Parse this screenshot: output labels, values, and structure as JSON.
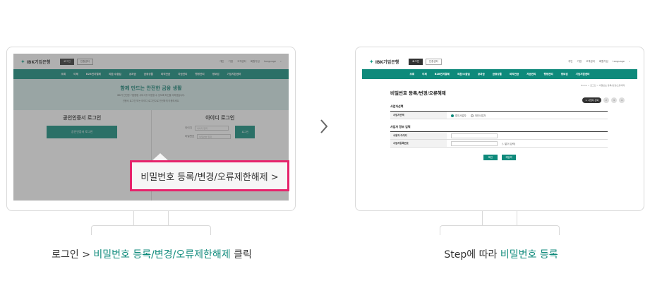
{
  "left_screen": {
    "logo": "IBK기업은행",
    "login_button": "로그인",
    "join_button": "인증센터",
    "top_links": [
      "개인",
      "기업",
      "고객센터",
      "회원가입",
      "Language"
    ],
    "nav": [
      "조회",
      "이체",
      "B2B전자결제",
      "외환/수출입",
      "공과금",
      "금융상품",
      "퇴직연금",
      "자금관리",
      "행정관리",
      "정보검",
      "기업지원센터"
    ],
    "hero_title": "함께 만드는 안전한 금융 생활",
    "hero_text_1": "IBK가 안전한 기업뱅킹 서비스를 이용할 수 있도록 최선을 다하겠습니다.",
    "hero_text_2": "인증서 로그인 또는 아이디 로그인으로 안전하게 이용하세요.",
    "cert_login_title": "공인인증서 로그인",
    "cert_login_button": "공인인증서 로그인",
    "id_login_title": "아이디 로그인",
    "id_label": "아이디",
    "pw_label": "비밀번호",
    "id_placeholder": "아이디 입력",
    "pw_placeholder": "비밀번호 입력",
    "id_login_button": "로그인",
    "callout": "비밀번호 등록/변경/오류제한해제 >"
  },
  "right_screen": {
    "logo": "IBK기업은행",
    "login_button": "로그인",
    "join_button": "인증센터",
    "page_title": "비밀번호 등록/변경/오류해제",
    "breadcrumb": "Home > 로그인 > 비밀번호 등록/변경/오류해제",
    "step_active": "1. 사업자 선택",
    "steps": [
      "2",
      "3",
      "4"
    ],
    "section1_title": "사업자선택",
    "section1_row_label": "사업자선택",
    "radio_options": [
      "법인사업자",
      "개인사업자"
    ],
    "section2_title": "사업자 정보 입력",
    "section2_rows": [
      "사용자 아이디",
      "사업자등록번호"
    ],
    "hint": "('-'없이 입력)",
    "buttons": [
      "확인",
      "재입력"
    ]
  },
  "captions": {
    "left_prefix": "로그인 > ",
    "left_highlight": "비밀번호 등록/변경/오류제한해제",
    "left_suffix": " 클릭",
    "right_prefix": "Step에 따라 ",
    "right_highlight": "비밀번호 등록"
  },
  "colors": {
    "accent": "#0e8a7b",
    "highlight_border": "#e6236b"
  }
}
